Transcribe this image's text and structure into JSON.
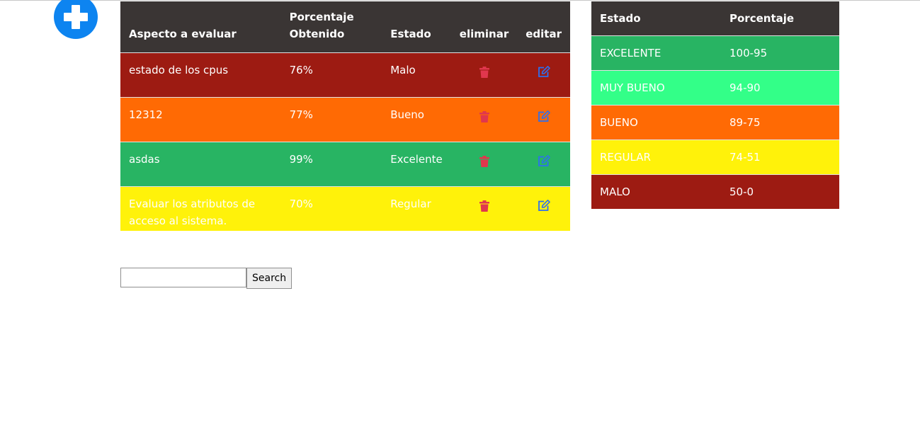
{
  "add_button": {
    "icon": "plus-circle-icon",
    "color": "#0d84f0"
  },
  "colors": {
    "header_bg": "#3a3534",
    "malo": "#9d1b12",
    "bueno": "#ff6a04",
    "excelente": "#28b463",
    "muy_bueno": "#33ff88",
    "regular": "#fff20a",
    "delete_icon": "#e0374d",
    "edit_icon": "#2d6ff0"
  },
  "main_table": {
    "headers": {
      "aspecto": "Aspecto a evaluar",
      "porcentaje_line1": "Porcentaje",
      "porcentaje_line2": "Obtenido",
      "estado": "Estado",
      "eliminar": "eliminar",
      "editar": "editar"
    },
    "rows": [
      {
        "aspecto": "estado de los cpus",
        "porcentaje": "76%",
        "estado": "Malo",
        "color": "#9d1b12",
        "delete_icon": "trash-icon",
        "edit_icon": "edit-icon"
      },
      {
        "aspecto": "12312",
        "porcentaje": "77%",
        "estado": "Bueno",
        "color": "#ff6a04",
        "delete_icon": "trash-icon",
        "edit_icon": "edit-icon"
      },
      {
        "aspecto": "asdas",
        "porcentaje": "99%",
        "estado": "Excelente",
        "color": "#28b463",
        "delete_icon": "trash-icon",
        "edit_icon": "edit-icon"
      },
      {
        "aspecto": "Evaluar los atributos de acceso al sistema.",
        "porcentaje": "70%",
        "estado": "Regular",
        "color": "#fff20a",
        "delete_icon": "trash-icon",
        "edit_icon": "edit-icon"
      }
    ]
  },
  "legend_table": {
    "headers": {
      "estado": "Estado",
      "porcentaje": "Porcentaje"
    },
    "rows": [
      {
        "estado": "EXCELENTE",
        "rango": "100-95",
        "color": "#28b463"
      },
      {
        "estado": "MUY BUENO",
        "rango": "94-90",
        "color": "#33ff88"
      },
      {
        "estado": "BUENO",
        "rango": "89-75",
        "color": "#ff6a04"
      },
      {
        "estado": "REGULAR",
        "rango": "74-51",
        "color": "#fff20a"
      },
      {
        "estado": "MALO",
        "rango": "50-0",
        "color": "#9d1b12"
      }
    ]
  },
  "search": {
    "value": "",
    "placeholder": "",
    "button_label": "Search"
  }
}
